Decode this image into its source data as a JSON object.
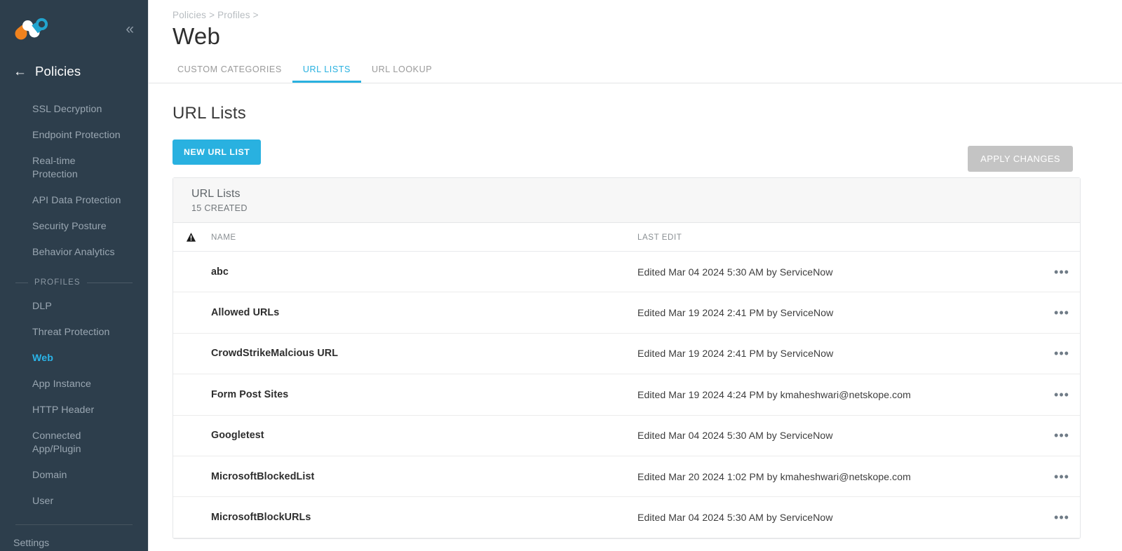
{
  "sidebar": {
    "logo_name": "netskope-logo",
    "collapse_icon": "«",
    "back_icon": "←",
    "section_title": "Policies",
    "items": [
      {
        "label": "SSL Decryption",
        "active": false
      },
      {
        "label": "Endpoint Protection",
        "active": false
      },
      {
        "label": "Real-time Protection",
        "active": false
      },
      {
        "label": "API Data Protection",
        "active": false
      },
      {
        "label": "Security Posture",
        "active": false
      },
      {
        "label": "Behavior Analytics",
        "active": false
      }
    ],
    "group_label": "PROFILES",
    "profile_items": [
      {
        "label": "DLP",
        "active": false
      },
      {
        "label": "Threat Protection",
        "active": false
      },
      {
        "label": "Web",
        "active": true
      },
      {
        "label": "App Instance",
        "active": false
      },
      {
        "label": "HTTP Header",
        "active": false
      },
      {
        "label": "Connected App/Plugin",
        "active": false
      },
      {
        "label": "Domain",
        "active": false
      },
      {
        "label": "User",
        "active": false
      }
    ],
    "settings_label": "Settings",
    "colors": {
      "bg": "#2d3e4c",
      "active": "#2ab4e8",
      "text": "#9aa7b2"
    }
  },
  "header": {
    "breadcrumb": "Policies > Profiles >",
    "title": "Web"
  },
  "tabs": [
    {
      "label": "CUSTOM CATEGORIES",
      "active": false
    },
    {
      "label": "URL LISTS",
      "active": true
    },
    {
      "label": "URL LOOKUP",
      "active": false
    }
  ],
  "main": {
    "section_title": "URL Lists",
    "new_button_label": "NEW URL LIST",
    "apply_button_label": "APPLY CHANGES",
    "accent_color": "#29b1e0",
    "disabled_color": "#c4c4c4"
  },
  "card": {
    "title": "URL Lists",
    "subtitle": "15 CREATED",
    "warning_icon": "warning-triangle-icon",
    "columns": [
      "NAME",
      "LAST EDIT"
    ],
    "row_menu_icon": "•••",
    "rows": [
      {
        "name": "abc",
        "last_edit": "Edited Mar 04 2024 5:30 AM by ServiceNow"
      },
      {
        "name": "Allowed URLs",
        "last_edit": "Edited Mar 19 2024 2:41 PM by ServiceNow"
      },
      {
        "name": "CrowdStrikeMalcious URL",
        "last_edit": "Edited Mar 19 2024 2:41 PM by ServiceNow"
      },
      {
        "name": "Form Post Sites",
        "last_edit": "Edited Mar 19 2024 4:24 PM by kmaheshwari@netskope.com"
      },
      {
        "name": "Googletest",
        "last_edit": "Edited Mar 04 2024 5:30 AM by ServiceNow"
      },
      {
        "name": "MicrosoftBlockedList",
        "last_edit": "Edited Mar 20 2024 1:02 PM by kmaheshwari@netskope.com"
      },
      {
        "name": "MicrosoftBlockURLs",
        "last_edit": "Edited Mar 04 2024 5:30 AM by ServiceNow"
      }
    ]
  }
}
